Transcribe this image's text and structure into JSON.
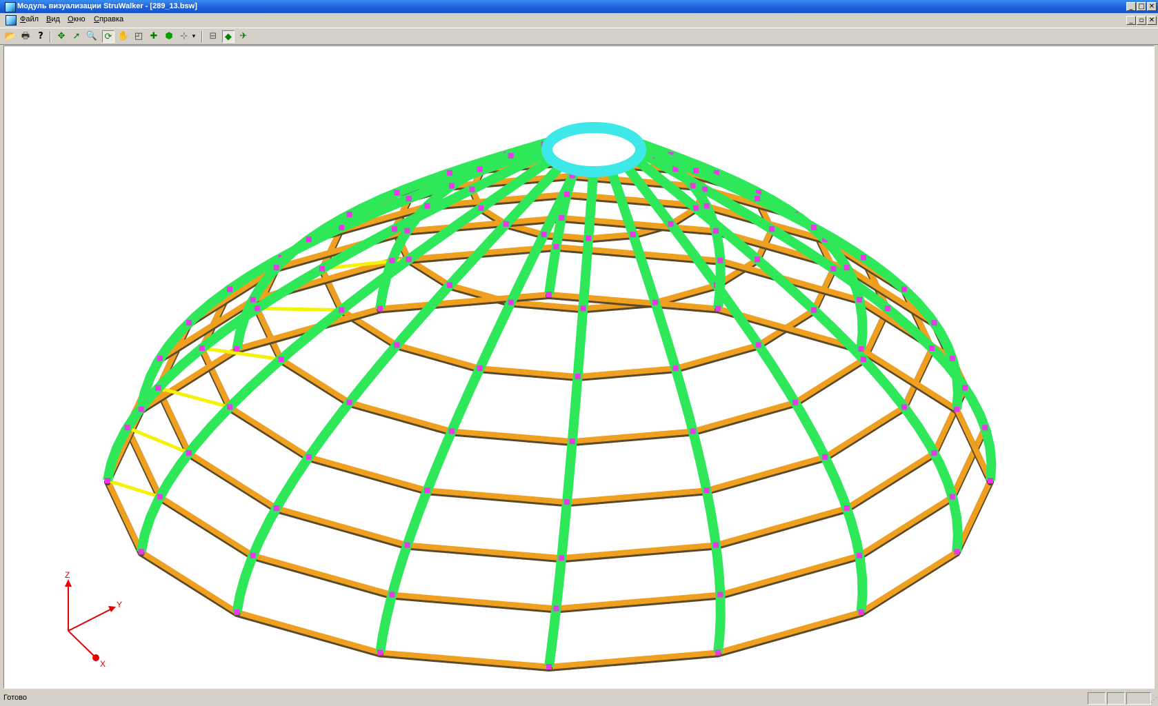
{
  "window": {
    "title": "Модуль визуализации StruWalker - [289_13.bsw]"
  },
  "menu": {
    "items": [
      {
        "label": "Файл",
        "key": "Ф",
        "rest": "айл"
      },
      {
        "label": "Вид",
        "key": "В",
        "rest": "ид"
      },
      {
        "label": "Окно",
        "key": "О",
        "rest": "кно"
      },
      {
        "label": "Справка",
        "key": "С",
        "rest": "правка"
      }
    ]
  },
  "toolbar": {
    "tools": [
      "open",
      "print",
      "help",
      "move",
      "select",
      "zoom",
      "rotate",
      "pan",
      "zoom-window",
      "add-node",
      "solid-view",
      "axes",
      "dimensions",
      "render",
      "section"
    ]
  },
  "axes": {
    "x_label": "X",
    "y_label": "Y",
    "z_label": "Z"
  },
  "statusbar": {
    "text": "Готово"
  },
  "colors": {
    "rib": "#2ee85a",
    "ring_beam": "#f0a020",
    "brace": "#f5f20a",
    "crown_ring": "#3fe8e8",
    "joint": "#e83ae8",
    "axis": "#e60000"
  }
}
